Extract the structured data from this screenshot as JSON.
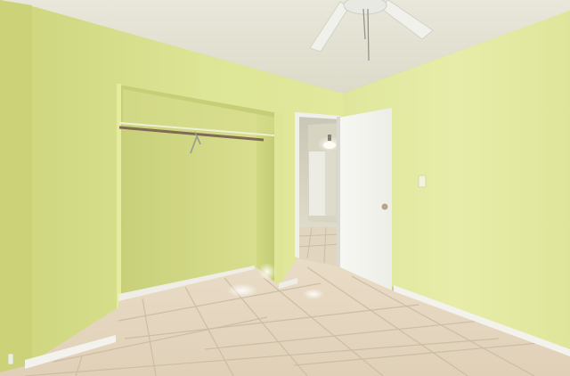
{
  "scene": {
    "kind": "photo",
    "elements": [
      "ceiling",
      "ceiling-fan",
      "left-wall",
      "right-wall",
      "open-closet",
      "closet-rod",
      "wire-hanger",
      "open-doorway",
      "hallway-light",
      "open-door",
      "door-knob",
      "light-switch",
      "tile-floor",
      "baseboards",
      "wall-outlet"
    ]
  },
  "colors": {
    "wall_light": "#e4eaa2",
    "wall_mid": "#d3da86",
    "wall_shadow": "#b9c06a",
    "ceiling": "#e8e6d8",
    "door": "#f6f6f1",
    "floor": "#e6d7c0",
    "grout": "#cbbba4",
    "baseboard": "#f3f2ec"
  }
}
